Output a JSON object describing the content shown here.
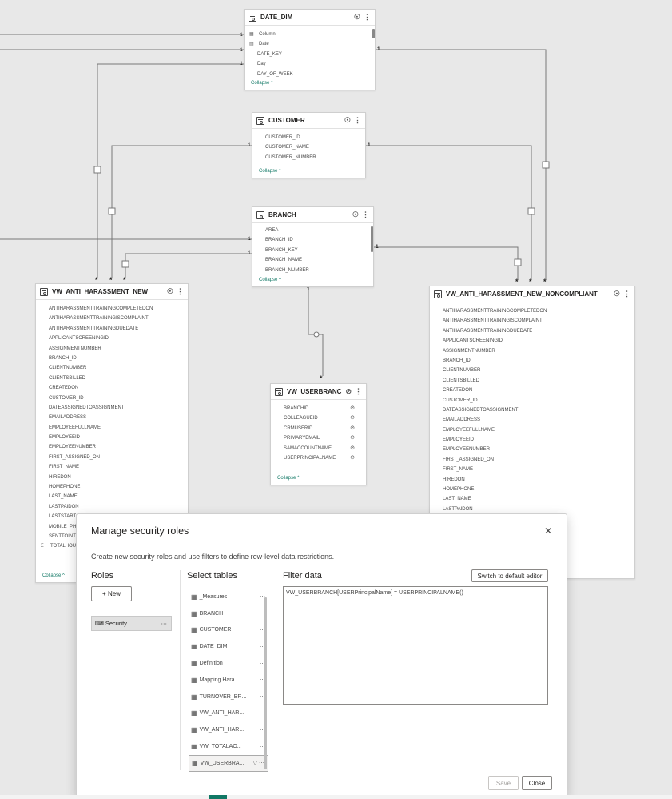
{
  "model_view": {
    "tables": {
      "date_dim": {
        "name": "DATE_DIM",
        "fields": [
          "Column",
          "Date",
          "DATE_KEY",
          "Day",
          "DAY_OF_WEEK"
        ],
        "collapse_label": "Collapse ^"
      },
      "customer": {
        "name": "CUSTOMER",
        "fields": [
          "CUSTOMER_ID",
          "CUSTOMER_NAME",
          "CUSTOMER_NUMBER"
        ],
        "collapse_label": "Collapse ^"
      },
      "branch": {
        "name": "BRANCH",
        "fields": [
          "AREA",
          "BRANCH_ID",
          "BRANCH_KEY",
          "BRANCH_NAME",
          "BRANCH_NUMBER"
        ],
        "collapse_label": "Collapse ^"
      },
      "vw_anti_harassment_new": {
        "name": "VW_ANTI_HARASSMENT_NEW",
        "fields": [
          "ANTIHARASSMENTTRAININGCOMPLETEDON",
          "ANTIHARASSMENTTRAININGISCOMPLAINT",
          "ANTIHARASSMENTTRAININGDUEDATE",
          "APPLICANTSCREENINGID",
          "ASSIGNMENTNUMBER",
          "BRANCH_ID",
          "CLIENTNUMBER",
          "CLIENTSBILLED",
          "CREATEDON",
          "CUSTOMER_ID",
          "DATEASSIGNEDTOASSIGNMENT",
          "EMAILADDRESS",
          "EMPLOYEEFULLNAME",
          "EMPLOYEEID",
          "EMPLOYEENUMBER",
          "FIRST_ASSIGNED_ON",
          "FIRST_NAME",
          "HIREDON",
          "HOMEPHONE",
          "LAST_NAME",
          "LASTPAIDON",
          "LASTSTARTO",
          "MOBILE_PH",
          "SENTTOINT",
          "TOTALHOU"
        ],
        "collapse_label": "Collapse ^"
      },
      "vw_userbranch": {
        "name": "VW_USERBRANCH",
        "fields": [
          "BRANCHID",
          "COLLEAGUEID",
          "CRMUSERID",
          "PRIMARYEMAIL",
          "SAMACCOUNTNAME",
          "USERPRINCIPALNAME"
        ],
        "collapse_label": "Collapse ^"
      },
      "vw_noncompliant": {
        "name": "VW_ANTI_HARASSMENT_NEW_NONCOMPLIANT",
        "fields": [
          "ANTIHARASSMENTTRAININGCOMPLETEDON",
          "ANTIHARASSMENTTRAININGISCOMPLAINT",
          "ANTIHARASSMENTTRAININGDUEDATE",
          "APPLICANTSCREENINGID",
          "ASSIGNMENTNUMBER",
          "BRANCH_ID",
          "CLIENTNUMBER",
          "CLIENTSBILLED",
          "CREATEDON",
          "CUSTOMER_ID",
          "DATEASSIGNEDTOASSIGNMENT",
          "EMAILADDRESS",
          "EMPLOYEEFULLNAME",
          "EMPLOYEEID",
          "EMPLOYEENUMBER",
          "FIRST_ASSIGNED_ON",
          "FIRST_NAME",
          "HIREDON",
          "HOMEPHONE",
          "LAST_NAME",
          "LASTPAIDON"
        ]
      }
    },
    "cardinality": {
      "one": "1",
      "many": "*"
    }
  },
  "dialog": {
    "title": "Manage security roles",
    "description": "Create new security roles and use filters to define row-level data restrictions.",
    "roles_heading": "Roles",
    "new_button": "+ New",
    "roles": [
      "Security"
    ],
    "select_tables_heading": "Select tables",
    "tables": [
      "_Measures",
      "BRANCH",
      "CUSTOMER",
      "DATE_DIM",
      "Definition",
      "Mapping Hara...",
      "TURNOVER_BR...",
      "VW_ANTI_HAR...",
      "VW_ANTI_HAR...",
      "VW_TOTALAO...",
      "VW_USERBRA..."
    ],
    "filter_heading": "Filter data",
    "switch_editor_button": "Switch to default editor",
    "filter_expression": "VW_USERBRANCH[USERPrincipalName] = USERPRINCIPALNAME()",
    "save_button": "Save",
    "close_button": "Close"
  },
  "colors": {
    "accent": "#117865",
    "background": "#e8e8e8"
  }
}
